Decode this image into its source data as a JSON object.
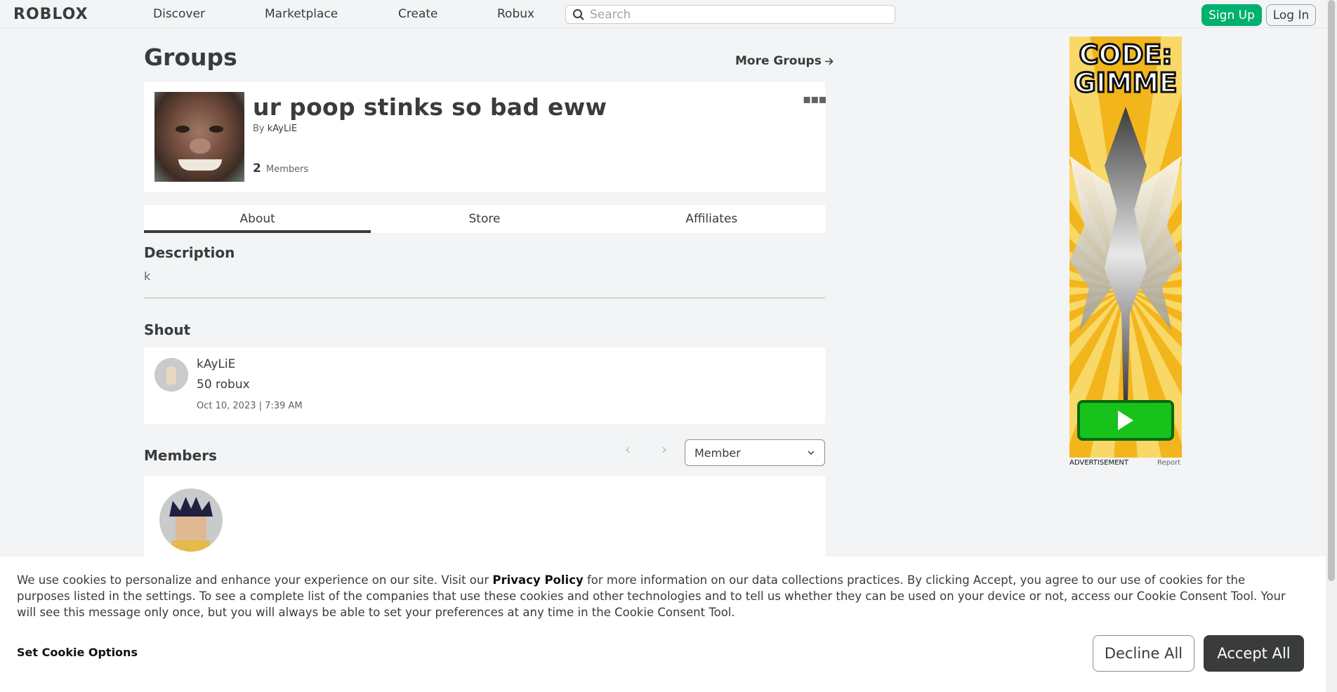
{
  "header": {
    "logo": "ROBLOX",
    "nav": [
      "Discover",
      "Marketplace",
      "Create",
      "Robux"
    ],
    "search_placeholder": "Search",
    "signup_label": "Sign Up",
    "login_label": "Log In"
  },
  "page": {
    "title": "Groups",
    "more_groups": "More Groups"
  },
  "group": {
    "name": "ur poop stinks so bad eww",
    "by_prefix": "By",
    "owner": "kAyLiE",
    "member_count": "2",
    "member_label": "Members",
    "more_icon": "ellipsis-icon"
  },
  "tabs": [
    "About",
    "Store",
    "Affiliates"
  ],
  "active_tab": "About",
  "about": {
    "description_title": "Description",
    "description_text": "k",
    "shout_title": "Shout",
    "shout": {
      "user": "kAyLiE",
      "message": "50 robux",
      "date": "Oct 10, 2023 | 7:39 AM"
    },
    "members_title": "Members",
    "role_filter": "Member"
  },
  "ad": {
    "headline": "CODE: GIMME",
    "label": "ADVERTISEMENT",
    "report": "Report"
  },
  "cookie": {
    "text_before": "We use cookies to personalize and enhance your experience on our site. Visit our ",
    "privacy_link": "Privacy Policy",
    "text_after": " for more information on our data collections practices. By clicking Accept, you agree to our use of cookies for the purposes listed in the settings. To see a complete list of the companies that use these cookies and other technologies and to tell us whether they can be used on your device or not, access our Cookie Consent Tool. Your will see this message only once, but you will always be able to set your preferences at any time in the Cookie Consent Tool.",
    "set_options": "Set Cookie Options",
    "decline": "Decline All",
    "accept": "Accept All"
  },
  "colors": {
    "accent_green": "#00b06f",
    "text_dark": "#393b3d",
    "background": "#f2f4f5"
  }
}
